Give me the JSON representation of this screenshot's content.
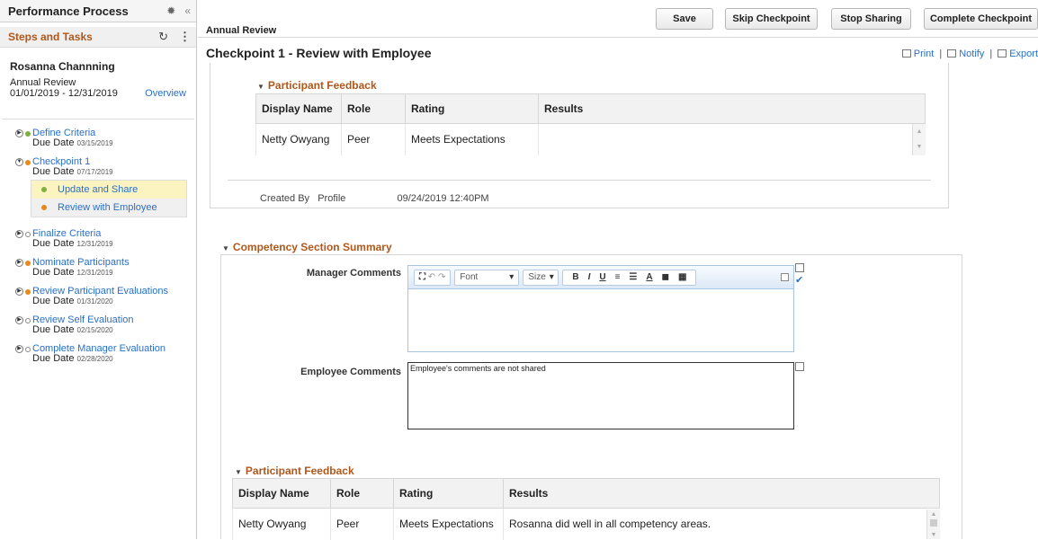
{
  "left_panel": {
    "title": "Performance Process",
    "collapse_glyph": "«",
    "steps_title": "Steps and Tasks",
    "employee_name": "Rosanna Channning",
    "document_type": "Annual Review",
    "period": "01/01/2019 - 12/31/2019",
    "overview_link": "Overview",
    "steps": [
      {
        "label": "Define Criteria",
        "due_label": "Due Date",
        "due": "03/15/2019",
        "status": "green"
      },
      {
        "label": "Checkpoint 1",
        "due_label": "Due Date",
        "due": "07/17/2019",
        "status": "orange"
      },
      {
        "label": "Finalize Criteria",
        "due_label": "Due Date",
        "due": "12/31/2019",
        "status": "empty"
      },
      {
        "label": "Nominate Participants",
        "due_label": "Due Date",
        "due": "12/31/2019",
        "status": "orange"
      },
      {
        "label": "Review Participant Evaluations",
        "due_label": "Due Date",
        "due": "01/31/2020",
        "status": "orange"
      },
      {
        "label": "Review Self Evaluation",
        "due_label": "Due Date",
        "due": "02/15/2020",
        "status": "empty"
      },
      {
        "label": "Complete Manager Evaluation",
        "due_label": "Due Date",
        "due": "02/28/2020",
        "status": "empty"
      }
    ],
    "subtasks": [
      {
        "label": "Update and Share",
        "status": "green"
      },
      {
        "label": "Review with Employee",
        "status": "orange"
      }
    ]
  },
  "toolbar": {
    "doc_title": "Annual Review",
    "save": "Save",
    "skip": "Skip Checkpoint",
    "stop": "Stop Sharing",
    "complete": "Complete Checkpoint"
  },
  "page": {
    "title": "Checkpoint 1 - Review with Employee",
    "print": "Print",
    "notify": "Notify",
    "export": "Export"
  },
  "feedback_top": {
    "title": "Participant Feedback",
    "columns": [
      "Display Name",
      "Role",
      "Rating",
      "Results"
    ],
    "rows": [
      [
        "Netty Owyang",
        "Peer",
        "Meets Expectations",
        ""
      ]
    ],
    "created_by_label": "Created By",
    "created_by": "Profile",
    "created_at": "09/24/2019 12:40PM"
  },
  "competency": {
    "title": "Competency Section Summary",
    "manager_label": "Manager Comments",
    "employee_label": "Employee Comments",
    "employee_text": "Employee's comments are not shared",
    "rte_font": "Font",
    "rte_size": "Size"
  },
  "feedback_bottom": {
    "title": "Participant Feedback",
    "columns": [
      "Display Name",
      "Role",
      "Rating",
      "Results"
    ],
    "rows": [
      [
        "Netty Owyang",
        "Peer",
        "Meets Expectations",
        "Rosanna did well in all competency areas."
      ]
    ]
  }
}
